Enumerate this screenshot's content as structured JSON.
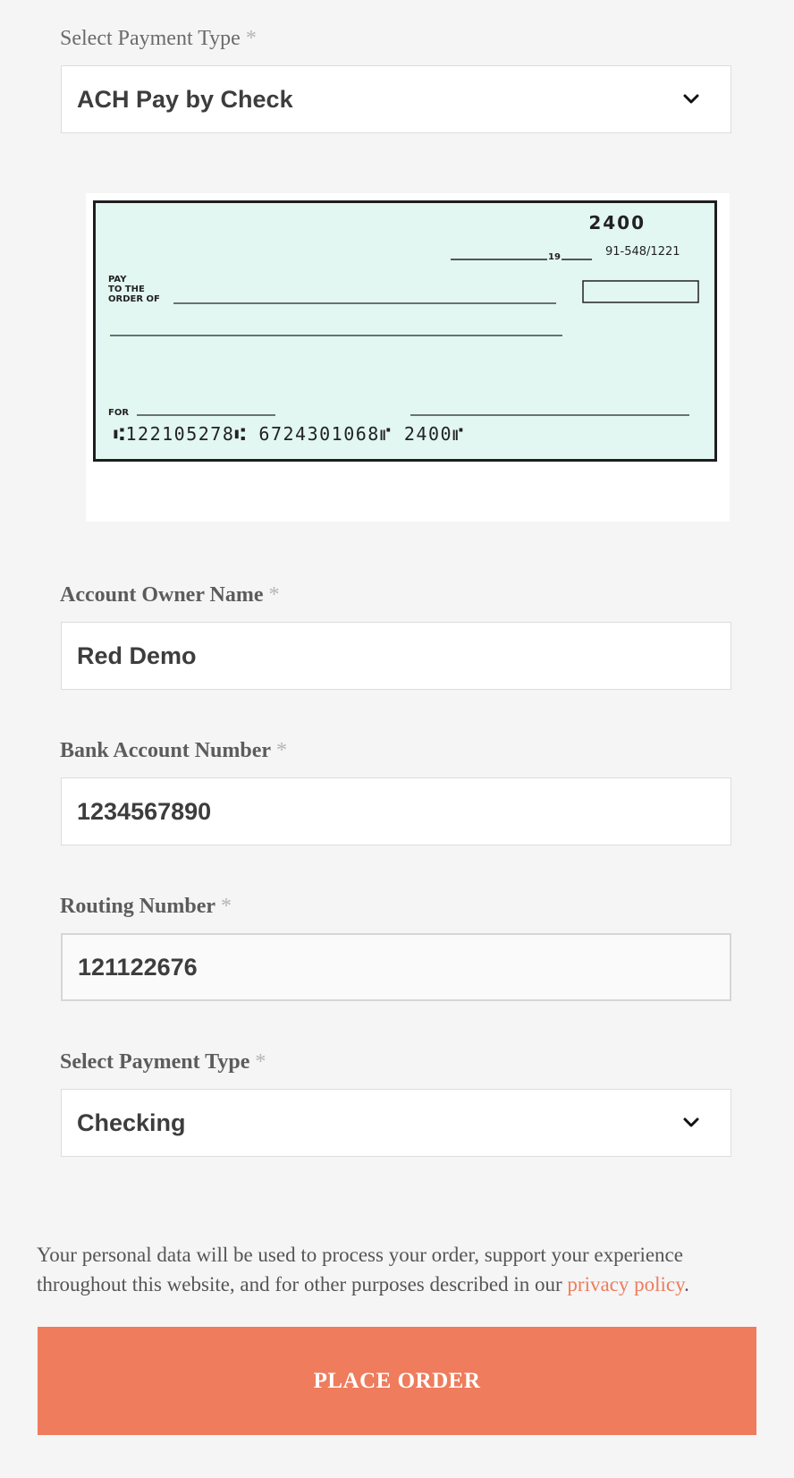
{
  "payment_type_select": {
    "label": "Select Payment Type",
    "required_mark": "*",
    "value": "ACH Pay by Check",
    "icon": "chevron-down-icon"
  },
  "check_image": {
    "check_number": "2400",
    "fraction_code": "91-548/1221",
    "date_suffix": "19",
    "pay_to_line1": "PAY",
    "pay_to_line2": "TO THE",
    "pay_to_line3": "ORDER OF",
    "memo_label": "FOR",
    "micr_line": "⑆122105278⑆  6724301068⑈  2400⑈"
  },
  "account_owner": {
    "label": "Account Owner Name",
    "required_mark": "*",
    "value": "Red Demo"
  },
  "bank_account": {
    "label": "Bank Account Number",
    "required_mark": "*",
    "value": "1234567890"
  },
  "routing_number": {
    "label": "Routing Number",
    "required_mark": "*",
    "value": "121122676"
  },
  "account_type_select": {
    "label": "Select Payment Type",
    "required_mark": "*",
    "value": "Checking",
    "icon": "chevron-down-icon"
  },
  "privacy_notice": {
    "text": "Your personal data will be used to process your order, support your experience throughout this website, and for other purposes described in our ",
    "link_text": "privacy policy",
    "end": "."
  },
  "place_order_button": {
    "label": "PLACE ORDER"
  },
  "colors": {
    "accent": "#ee7c5d",
    "background": "#f5f5f5",
    "check_background": "#e2f7f1"
  }
}
